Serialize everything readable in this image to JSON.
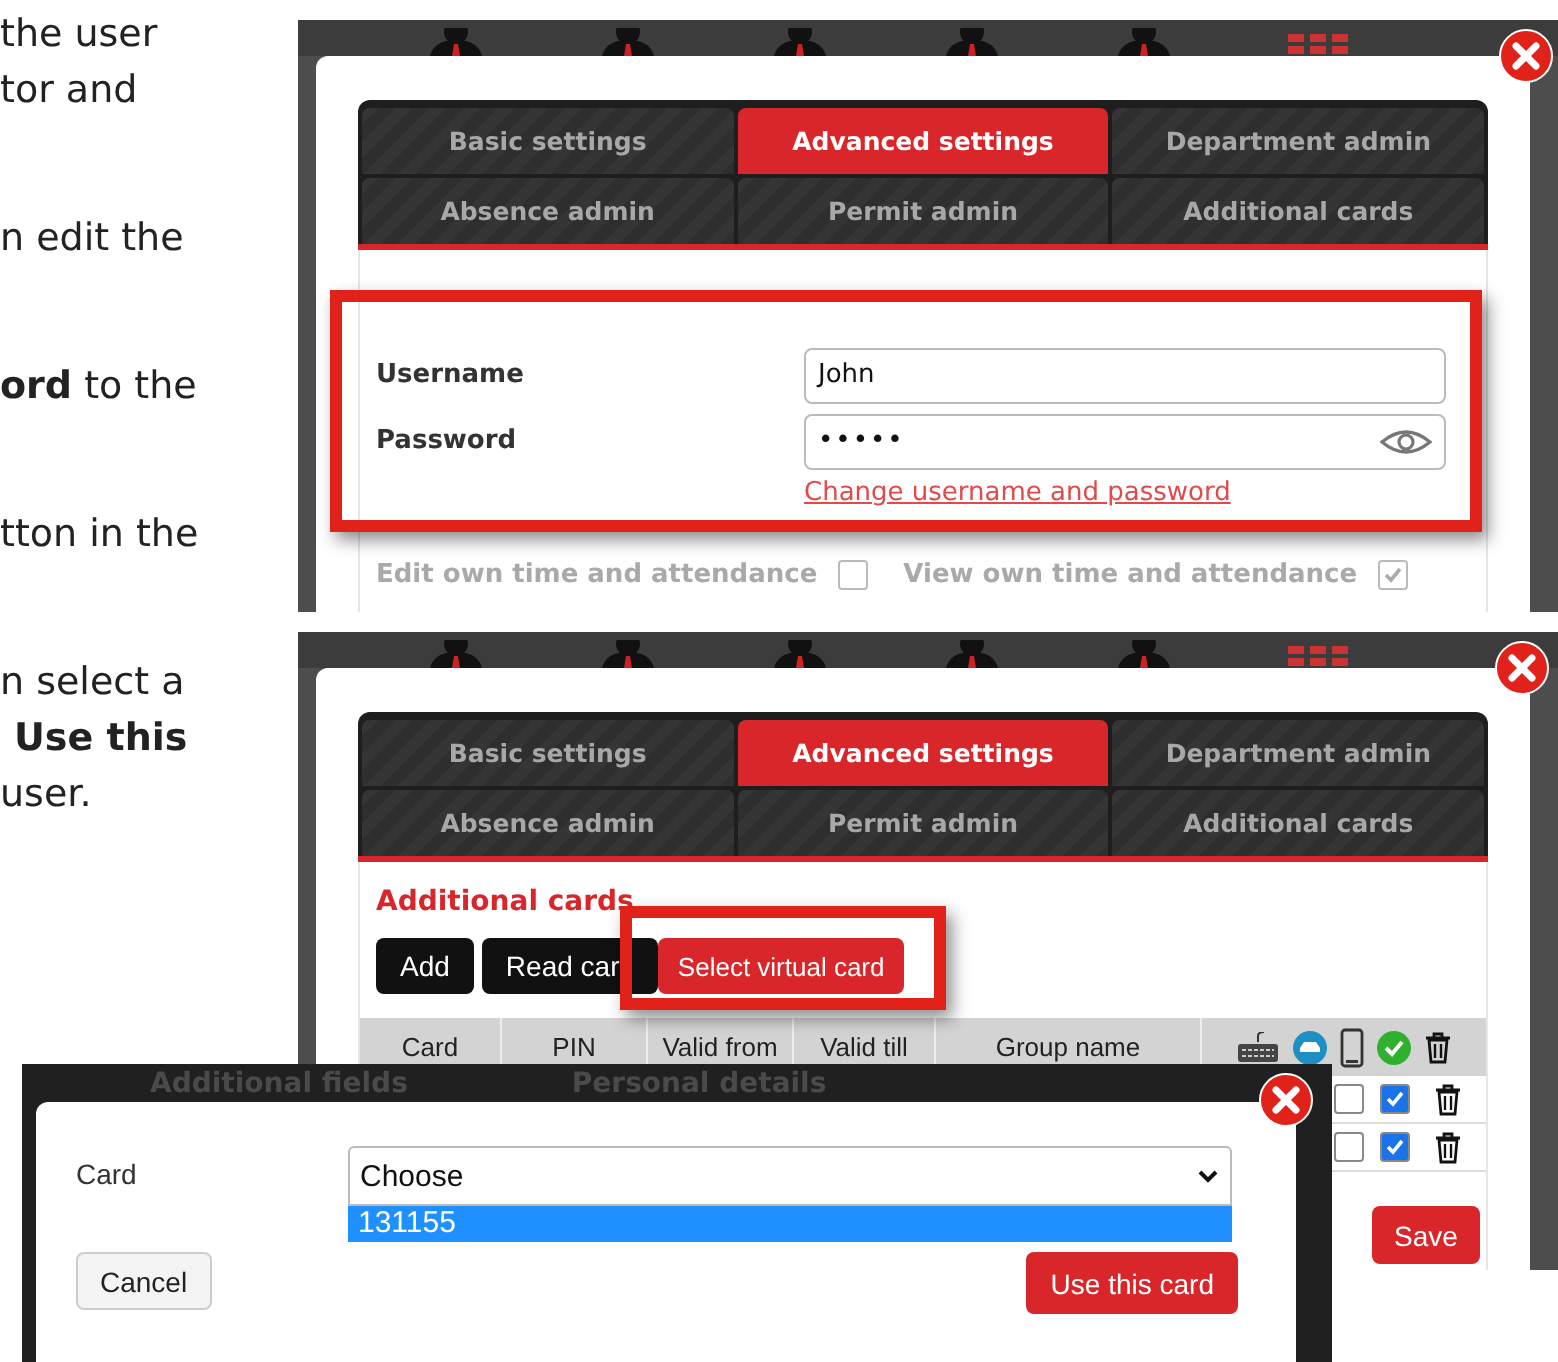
{
  "instructions": {
    "paragraphs": [
      {
        "lines": [
          {
            "text": "the user"
          },
          {
            "text": "tor and"
          }
        ]
      },
      {
        "lines": [
          {
            "text": "n edit the"
          }
        ]
      },
      {
        "lines": [
          {
            "text": "**ord** to the"
          }
        ]
      },
      {
        "lines": [
          {
            "text": "tton in the"
          }
        ]
      },
      {
        "lines": [
          {
            "text": "n select a"
          },
          {
            "text": "Use this",
            "bold": true
          },
          {
            "text": "user."
          }
        ]
      }
    ]
  },
  "screenshots": [
    {
      "kind": "credentials",
      "tabs": [
        {
          "label": "Basic settings",
          "selected": false
        },
        {
          "label": "Advanced settings",
          "selected": true
        },
        {
          "label": "Department admin",
          "selected": false
        },
        {
          "label": "Absence admin",
          "selected": false
        },
        {
          "label": "Permit admin",
          "selected": false
        },
        {
          "label": "Additional cards",
          "selected": false
        }
      ],
      "fields": [
        {
          "label": "Username",
          "value": "John",
          "kind": "text"
        },
        {
          "label": "Password",
          "value": "•••••",
          "kind": "password"
        }
      ],
      "link": "Change username and password",
      "permissions": [
        {
          "label": "Edit own time and attendance",
          "checked": false
        },
        {
          "label": "View own time and attendance",
          "checked": true
        }
      ]
    },
    {
      "kind": "cards",
      "tabs": [
        {
          "label": "Basic settings",
          "selected": false
        },
        {
          "label": "Advanced settings",
          "selected": true
        },
        {
          "label": "Department admin",
          "selected": false
        },
        {
          "label": "Absence admin",
          "selected": false
        },
        {
          "label": "Permit admin",
          "selected": false
        },
        {
          "label": "Additional cards",
          "selected": false
        }
      ],
      "heading": "Additional cards",
      "buttons": [
        {
          "label": "Add",
          "kind": "dark"
        },
        {
          "label": "Read car",
          "kind": "dark"
        },
        {
          "label": "Select virtual card",
          "kind": "primary"
        }
      ],
      "columns": [
        "Card",
        "PIN",
        "Valid from",
        "Valid till",
        "Group name"
      ],
      "rows": [
        {
          "mobile": false,
          "active": true
        },
        {
          "mobile": false,
          "active": true
        }
      ],
      "save": "Save"
    }
  ],
  "dialog": {
    "background_tabs": [
      "Additional fields",
      "Personal details"
    ],
    "label": "Card",
    "select": {
      "value": "Choose",
      "options": [
        {
          "label": "131155",
          "selected": true
        }
      ]
    },
    "cancel": "Cancel",
    "confirm": "Use this card"
  }
}
